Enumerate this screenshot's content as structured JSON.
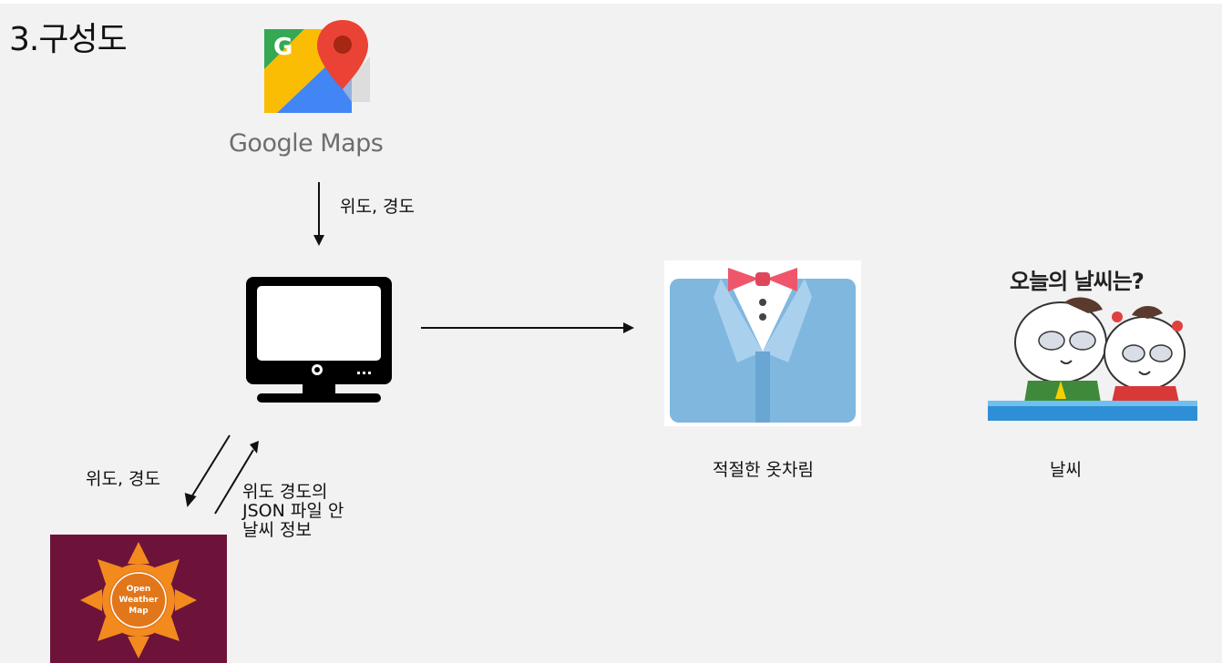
{
  "page": {
    "title": "3.구성도"
  },
  "nodes": {
    "google_maps": {
      "label": "Google Maps"
    },
    "computer": {},
    "outfit": {
      "label": "적절한 옷차림"
    },
    "weather": {
      "label": "날씨",
      "caption": "오늘의 날씨는?"
    },
    "openweathermap": {
      "label_lines": [
        "Open",
        "Weather",
        "Map"
      ]
    }
  },
  "edges": {
    "maps_to_computer": {
      "label": "위도, 경도"
    },
    "computer_to_owm": {
      "label": "위도, 경도"
    },
    "owm_to_computer": {
      "label_lines": [
        "위도 경도의",
        "JSON 파일 안",
        "날씨 정보"
      ]
    }
  },
  "colors": {
    "background": "#f2f2f2",
    "owm_bg": "#6d1238",
    "owm_sun": "#f28a1e",
    "suit_blue": "#7fb7df",
    "bowtie": "#f0566b",
    "desk_blue": "#2e8fd6",
    "maps_green": "#34a853",
    "maps_blue": "#4285f4",
    "maps_red": "#ea4335",
    "maps_yellow": "#fbbc04"
  }
}
